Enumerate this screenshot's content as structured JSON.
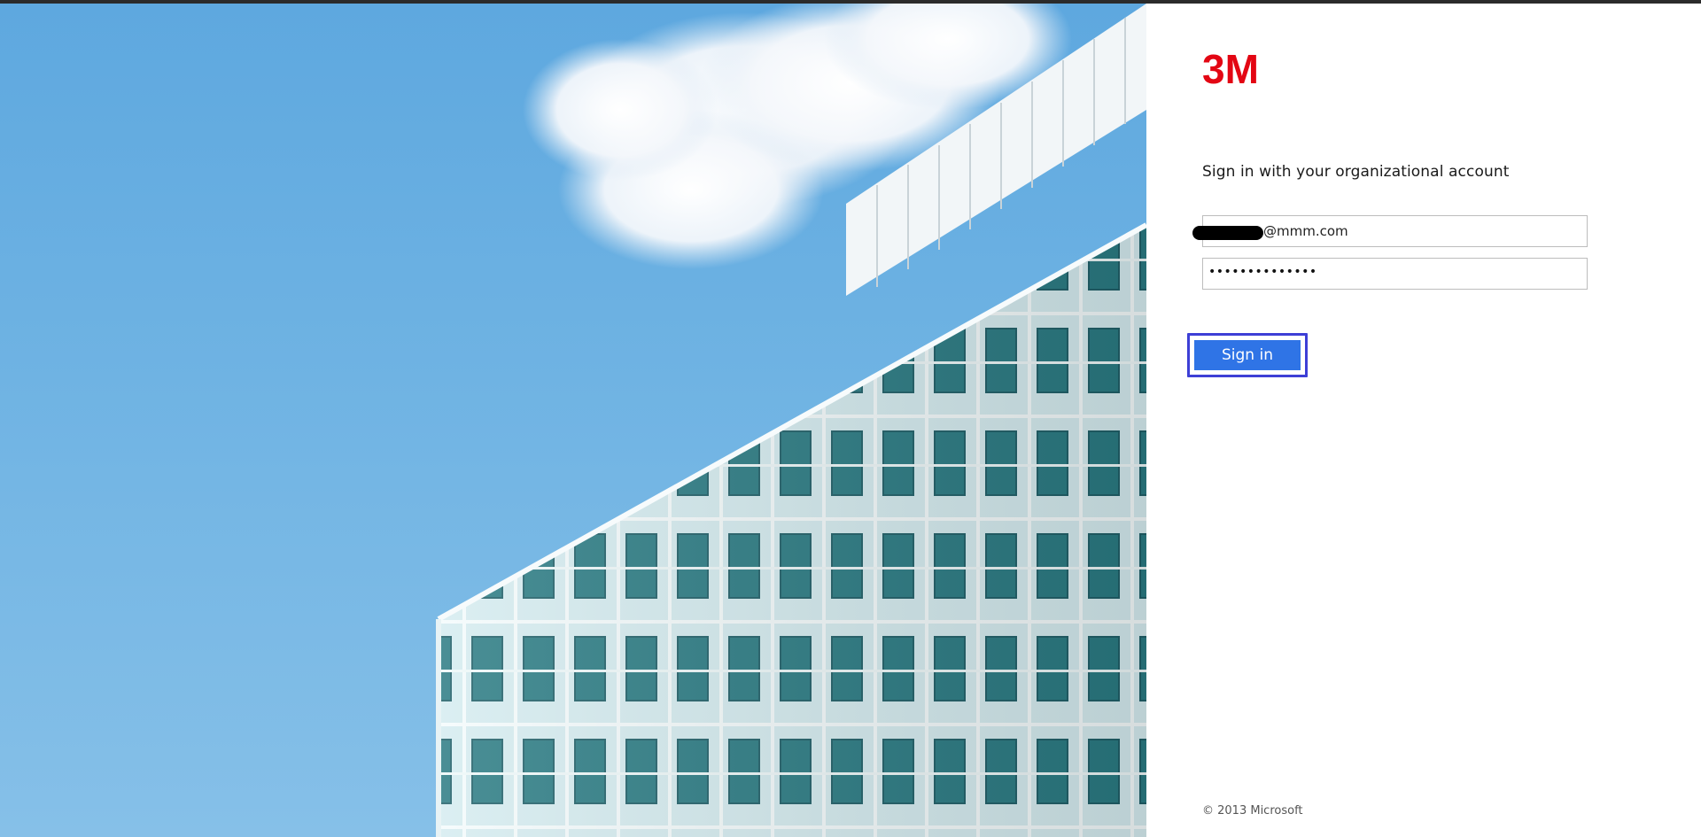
{
  "brand": {
    "logo_text": "3M",
    "logo_color": "#e30613"
  },
  "signin": {
    "heading": "Sign in with your organizational account",
    "username_value": "@mmm.com",
    "password_mask": "••••••••••••••",
    "button_label": "Sign in"
  },
  "footer": {
    "copyright": "© 2013 Microsoft"
  },
  "colors": {
    "button_bg": "#2f74e6",
    "focus_ring": "#3d3fd6",
    "sky": "#6fb3e3"
  },
  "icons": {
    "illustration": "building-and-sky-illustration"
  }
}
